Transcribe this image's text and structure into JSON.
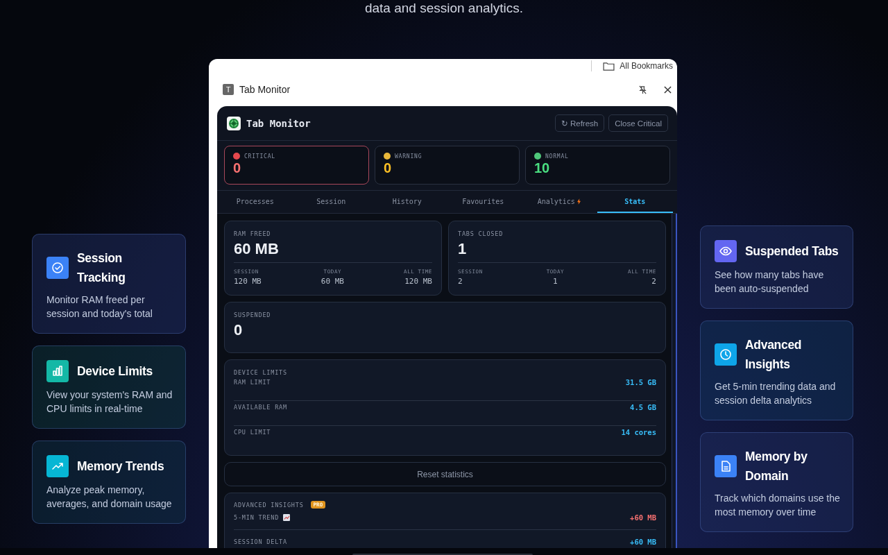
{
  "intro": "data and session analytics.",
  "browser": {
    "bookmarks": "All Bookmarks",
    "panel_badge": "T",
    "panel_title": "Tab Monitor"
  },
  "app": {
    "title": "Tab Monitor",
    "buttons": [
      "↻ Refresh",
      "Close Critical"
    ]
  },
  "status": [
    {
      "kind": "critical",
      "label": "CRITICAL",
      "value": "0",
      "color": "#e5484d"
    },
    {
      "kind": "warning",
      "label": "WARNING",
      "value": "0",
      "color": "#e8b73a"
    },
    {
      "kind": "normal",
      "label": "NORMAL",
      "value": "10",
      "color": "#4fc77a"
    }
  ],
  "tabs": [
    {
      "label": "Processes",
      "selected": false,
      "hot": false
    },
    {
      "label": "Session",
      "selected": false,
      "hot": false
    },
    {
      "label": "History",
      "selected": false,
      "hot": false
    },
    {
      "label": "Favourites",
      "selected": false,
      "hot": false
    },
    {
      "label": "Analytics",
      "selected": false,
      "hot": true
    },
    {
      "label": "Stats",
      "selected": true,
      "hot": false
    }
  ],
  "stats": [
    {
      "label": "RAM FREED",
      "value": "60 MB",
      "breakdown": [
        {
          "label": "SESSION",
          "value": "120 MB"
        },
        {
          "label": "TODAY",
          "value": "60 MB"
        },
        {
          "label": "ALL TIME",
          "value": "120 MB"
        }
      ]
    },
    {
      "label": "TABS CLOSED",
      "value": "1",
      "breakdown": [
        {
          "label": "SESSION",
          "value": "2"
        },
        {
          "label": "TODAY",
          "value": "1"
        },
        {
          "label": "ALL TIME",
          "value": "2"
        }
      ]
    }
  ],
  "suspended": {
    "label": "SUSPENDED",
    "value": "0"
  },
  "device_limits": {
    "title": "DEVICE LIMITS",
    "rows": [
      {
        "label": "RAM LIMIT",
        "value": "31.5 GB"
      },
      {
        "label": "AVAILABLE RAM",
        "value": "4.5 GB"
      },
      {
        "label": "CPU LIMIT",
        "value": "14 cores"
      }
    ]
  },
  "reset_button": "Reset statistics",
  "insights": {
    "title": "ADVANCED INSIGHTS",
    "badge": "PRO",
    "rows": [
      {
        "kind": "trend",
        "label": "5-MIN TREND",
        "value": "+60 MB",
        "color": "#f87171"
      },
      {
        "kind": "plain",
        "label": "SESSION DELTA",
        "value": "+60 MB",
        "color": "#38bdf8"
      }
    ]
  },
  "features_left": [
    {
      "kind": "check",
      "color": "#3b82f6",
      "title": "Session Tracking",
      "text": "Monitor RAM freed per session and today's total"
    },
    {
      "kind": "bars",
      "color": "#14b8a6",
      "title": "Device Limits",
      "text": "View your system's RAM and CPU limits in real-time"
    },
    {
      "kind": "trend",
      "color": "#06b6d4",
      "title": "Memory Trends",
      "text": "Analyze peak memory, averages, and domain usage"
    }
  ],
  "features_right": [
    {
      "kind": "eye",
      "color": "#6366f1",
      "title": "Suspended Tabs",
      "text": "See how many tabs have been auto-suspended"
    },
    {
      "kind": "clock",
      "color": "#0ea5e9",
      "title": "Advanced Insights",
      "text": "Get 5-min trending data and session delta analytics"
    },
    {
      "kind": "doc",
      "color": "#3b82f6",
      "title": "Memory by Domain",
      "text": "Track which domains use the most memory over time"
    }
  ]
}
